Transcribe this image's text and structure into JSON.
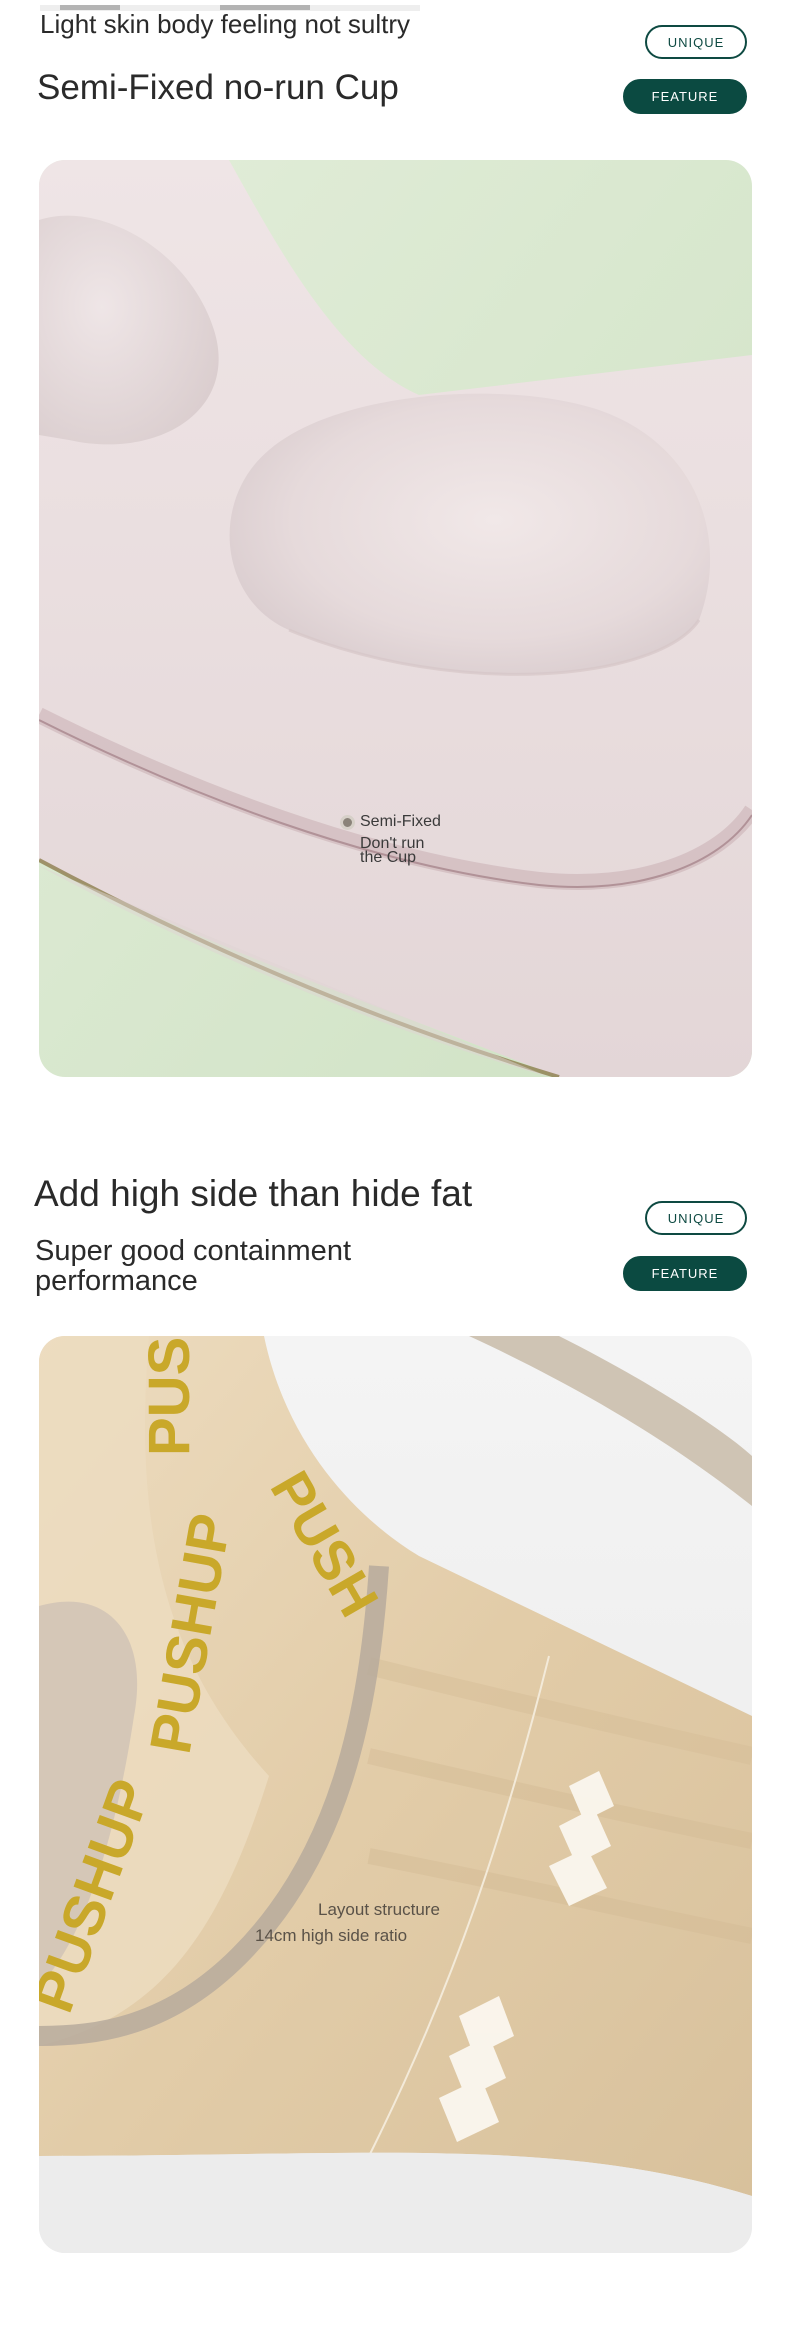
{
  "section1": {
    "subtitle": "Light skin body feeling not sultry",
    "title": "Semi-Fixed no-run Cup",
    "badge_unique": "UNIQUE",
    "badge_feature": "FEATURE",
    "callout_line1": "Semi-Fixed",
    "callout_line2": "Don't run",
    "callout_line3": "the Cup",
    "image_icon": "bra-cup-closeup-photo"
  },
  "section2": {
    "title": "Add high side than hide fat",
    "subtitle_line1": "Super good containment",
    "subtitle_line2": "performance",
    "badge_unique": "UNIQUE",
    "badge_feature": "FEATURE",
    "callout_line1": "Layout structure",
    "callout_line2": "14cm high side ratio",
    "band_text": "PUSHUP",
    "band_text_short": "PUSH",
    "image_icon": "bra-side-band-closeup-photo"
  },
  "colors": {
    "accent": "#0b4a41",
    "heading_text": "#2a2a2a",
    "pink_fabric": "#e9dcdc",
    "mint_background": "#d8e6cf",
    "beige_fabric": "#e3cfae",
    "band_lettering": "#c9a82a"
  }
}
